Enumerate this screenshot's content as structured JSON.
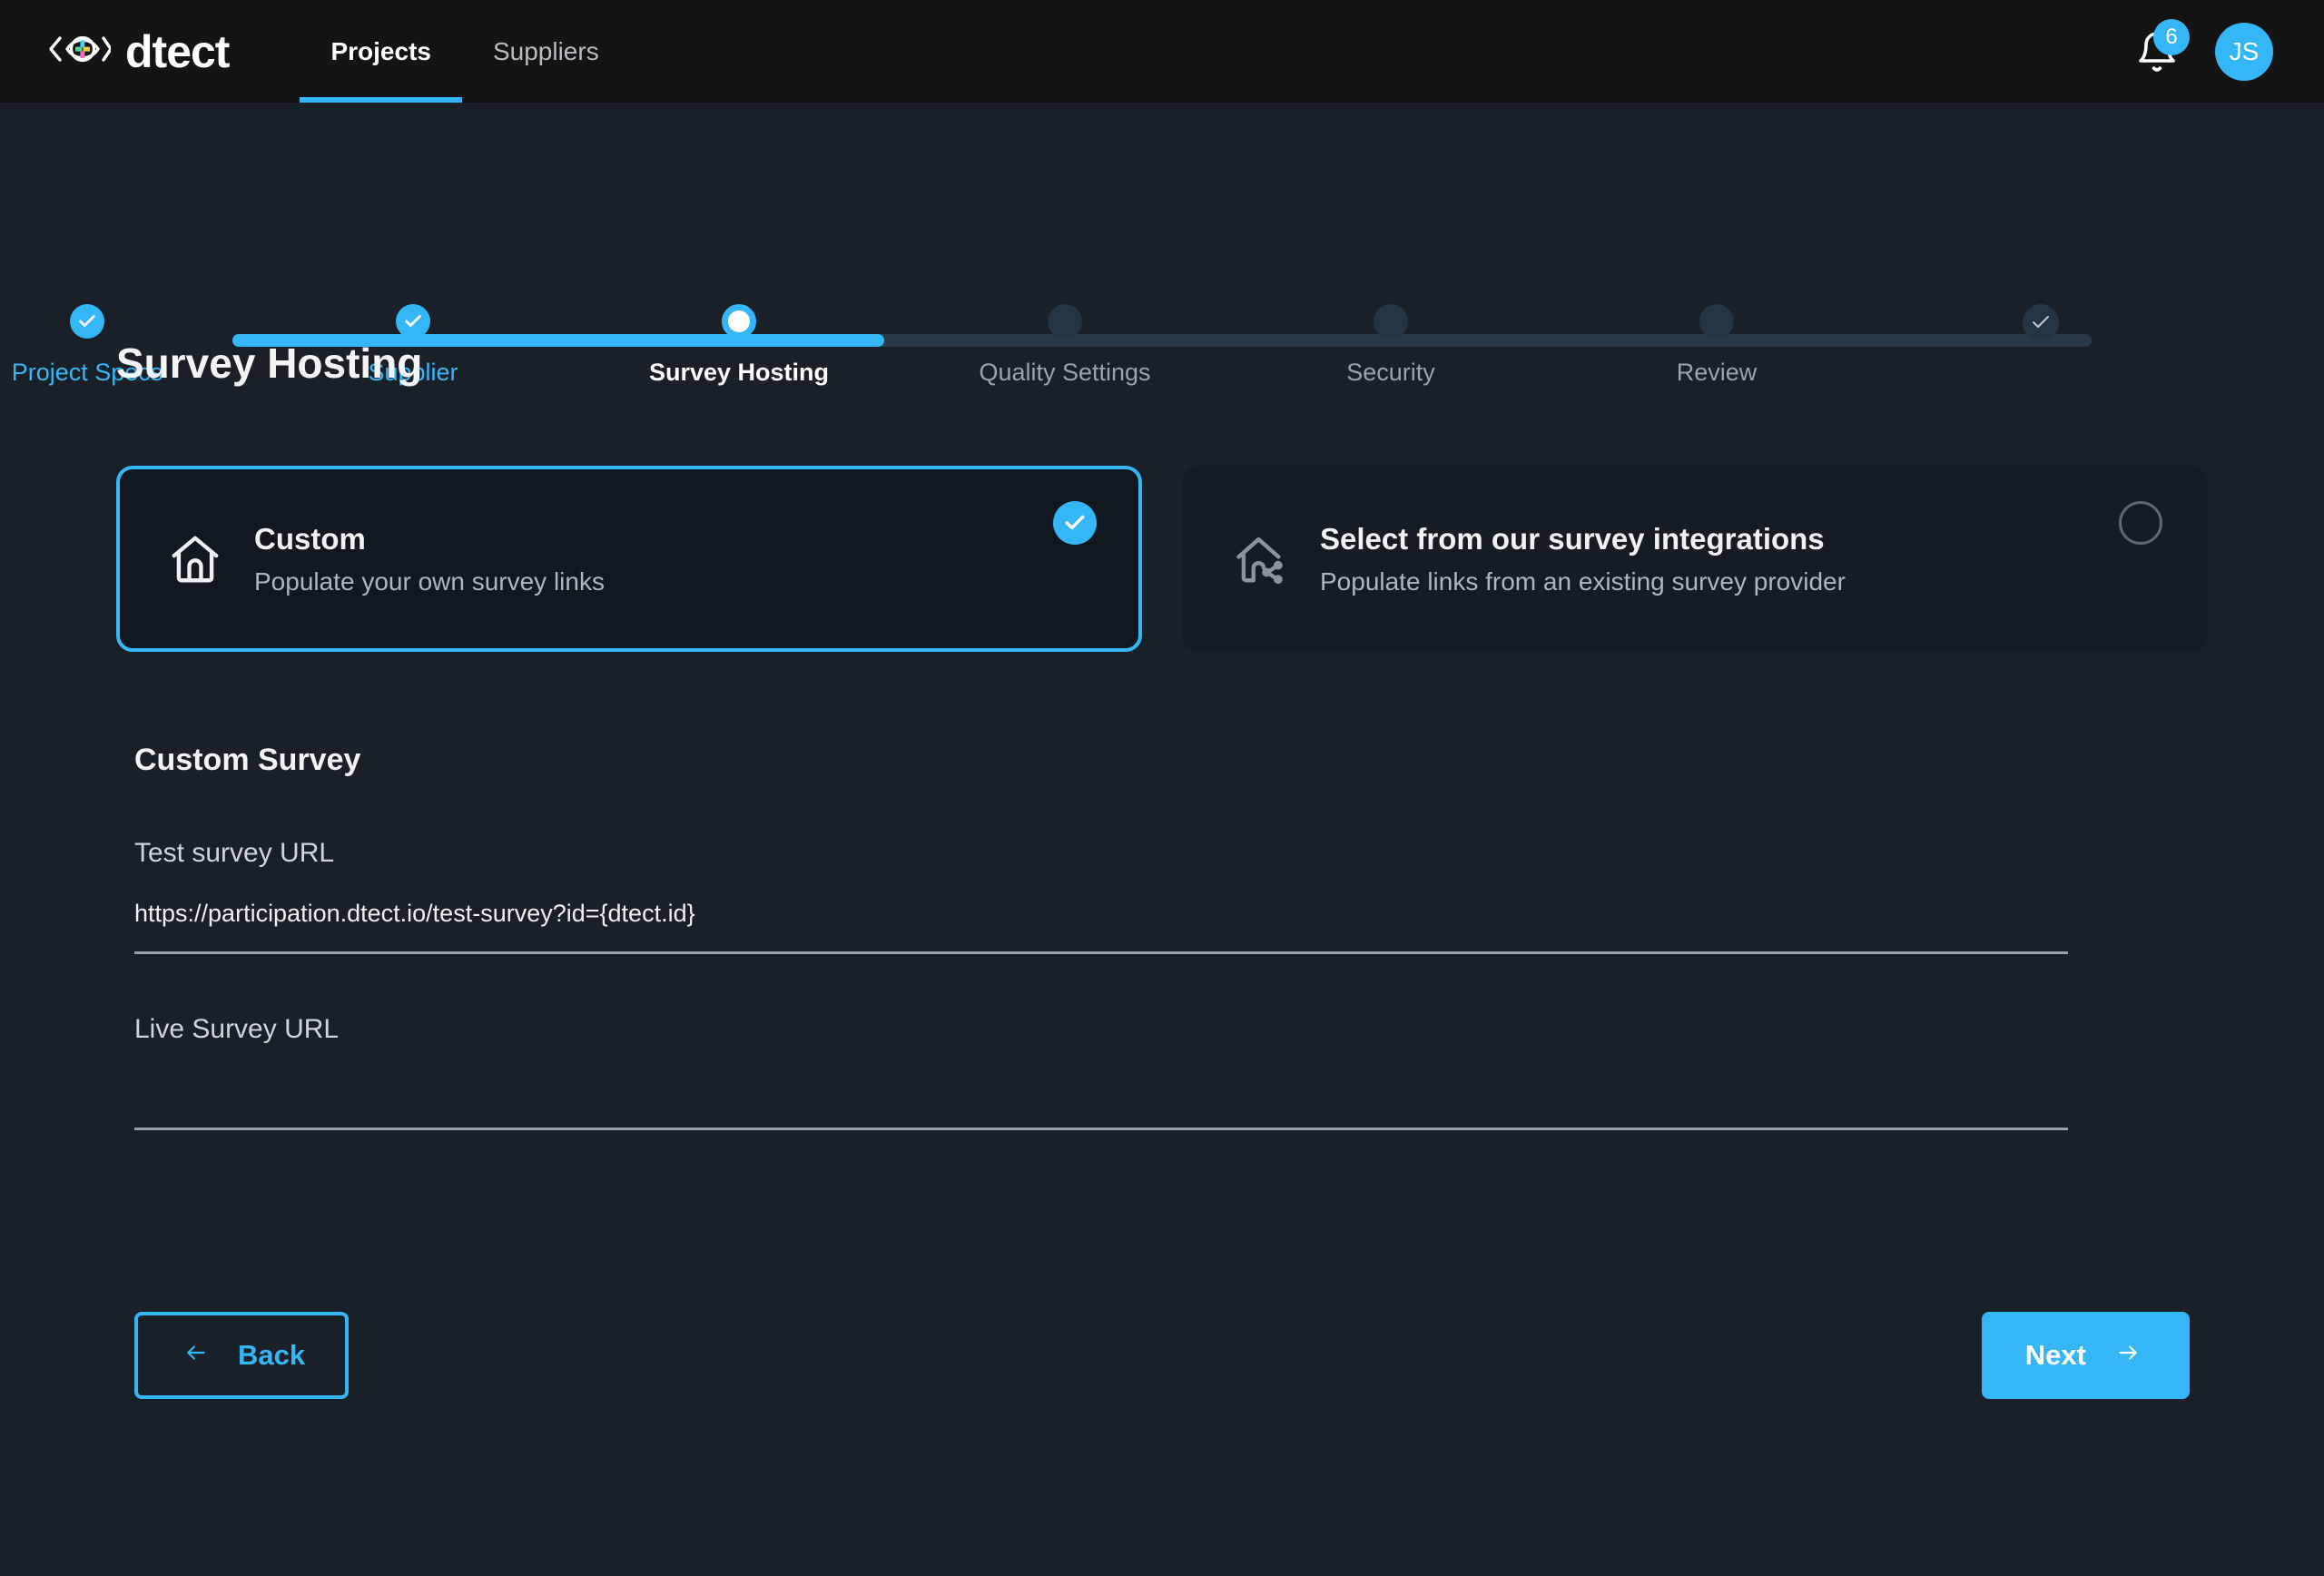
{
  "brand": {
    "name": "dtect",
    "logo_icon": "eye-plus-logo"
  },
  "nav": {
    "tabs": [
      {
        "label": "Projects",
        "active": true
      },
      {
        "label": "Suppliers",
        "active": false
      }
    ],
    "notifications": {
      "icon": "bell-icon",
      "count": "6"
    },
    "avatar": {
      "initials": "JS",
      "color": "#35b6f6"
    }
  },
  "stepper": {
    "steps": [
      {
        "label": "Project Specs",
        "state": "done"
      },
      {
        "label": "Supplier",
        "state": "done"
      },
      {
        "label": "Survey Hosting",
        "state": "current"
      },
      {
        "label": "Quality Settings",
        "state": "todo"
      },
      {
        "label": "Security",
        "state": "todo"
      },
      {
        "label": "Review",
        "state": "todo"
      }
    ],
    "end_marker_icon": "check-icon"
  },
  "page": {
    "title": "Survey Hosting"
  },
  "options": [
    {
      "title": "Custom",
      "subtitle": "Populate your own survey links",
      "icon": "home-icon",
      "selected": true,
      "check_icon": "check-icon"
    },
    {
      "title": "Select from our survey integrations",
      "subtitle": "Populate links from an existing survey provider",
      "icon": "home-share-icon",
      "selected": false,
      "check_icon": "radio-empty-icon"
    }
  ],
  "custom_survey": {
    "section_title": "Custom Survey",
    "fields": [
      {
        "label": "Test survey URL",
        "value": "https://participation.dtect.io/test-survey?id={dtect.id}",
        "placeholder": ""
      },
      {
        "label": "Live Survey URL",
        "value": "",
        "placeholder": ""
      }
    ]
  },
  "footer": {
    "back_label": "Back",
    "back_icon": "arrow-left-icon",
    "next_label": "Next",
    "next_icon": "arrow-right-icon"
  },
  "colors": {
    "accent": "#35b6f6",
    "background": "#192028",
    "topbar": "#141414",
    "card": "#151c24",
    "track": "#2a3949"
  }
}
